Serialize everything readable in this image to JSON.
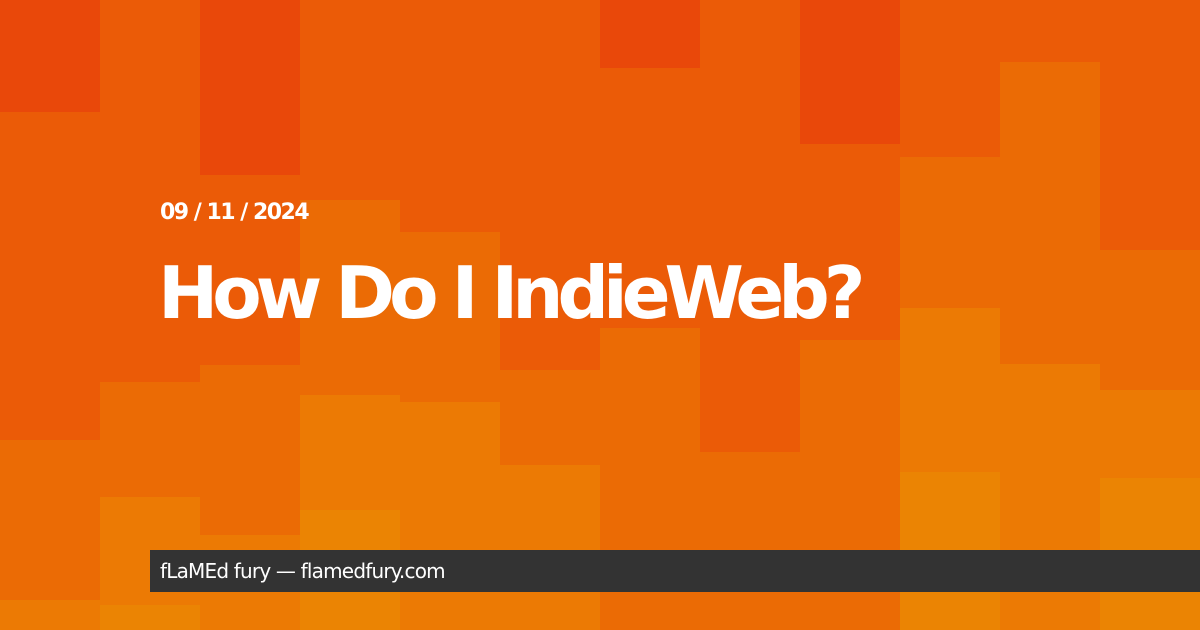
{
  "post": {
    "date": "09 / 11 / 2024",
    "title": "How Do I IndieWeb?"
  },
  "footer": {
    "text": "fLaMEd fury — flamedfury.com"
  },
  "colors": {
    "shades": [
      "#E9480A",
      "#EB5B07",
      "#EB6B05",
      "#EC7A04",
      "#EB8403"
    ],
    "footer_background": "#333333",
    "text": "#ffffff"
  }
}
